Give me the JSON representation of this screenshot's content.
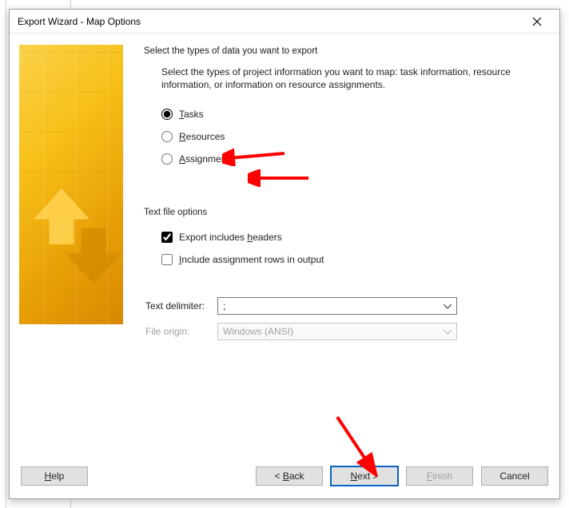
{
  "window": {
    "title": "Export Wizard - Map Options"
  },
  "section_title": "Select the types of data you want to export",
  "description": "Select the types of project information you want to map: task information, resource information, or information on resource assignments.",
  "data_types": {
    "tasks": {
      "label": "Tasks",
      "underline": "T",
      "selected": true
    },
    "resources": {
      "label": "Resources",
      "underline": "R",
      "selected": false
    },
    "assignments": {
      "label": "Assignments",
      "underline": "A",
      "selected": false
    }
  },
  "text_options_title": "Text file options",
  "text_options": {
    "headers": {
      "label": "Export includes headers",
      "underline": "h",
      "checked": true
    },
    "assignment_rows": {
      "label": "Include assignment rows in output",
      "underline": "I",
      "checked": false
    }
  },
  "delimiter": {
    "label": "Text delimiter:",
    "value": ";"
  },
  "origin": {
    "label": "File origin:",
    "value": "Windows (ANSI)",
    "disabled": true
  },
  "buttons": {
    "help": "Help",
    "back": "< Back",
    "next": "Next >",
    "finish": "Finish",
    "cancel": "Cancel"
  }
}
